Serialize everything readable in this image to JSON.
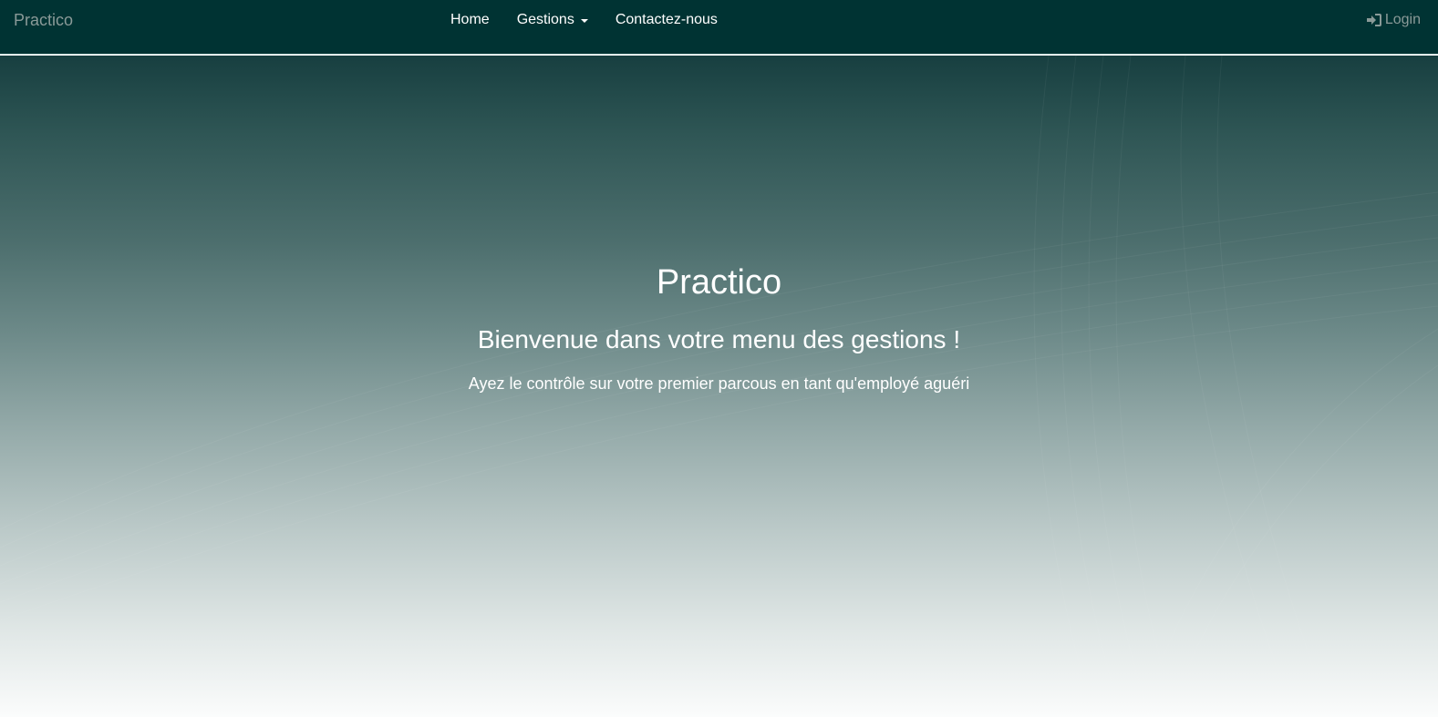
{
  "navbar": {
    "brand": "Practico",
    "links": [
      {
        "label": "Home"
      },
      {
        "label": "Gestions",
        "has_dropdown": true
      },
      {
        "label": "Contactez-nous"
      }
    ],
    "login_label": "Login",
    "login_icon": "sign-in-icon",
    "background_color": "#003333"
  },
  "hero": {
    "title": "Practico",
    "subtitle": "Bienvenue dans votre menu des gestions !",
    "text": "Ayez le contrôle sur votre premier parcous en tant qu'employé aguéri"
  }
}
